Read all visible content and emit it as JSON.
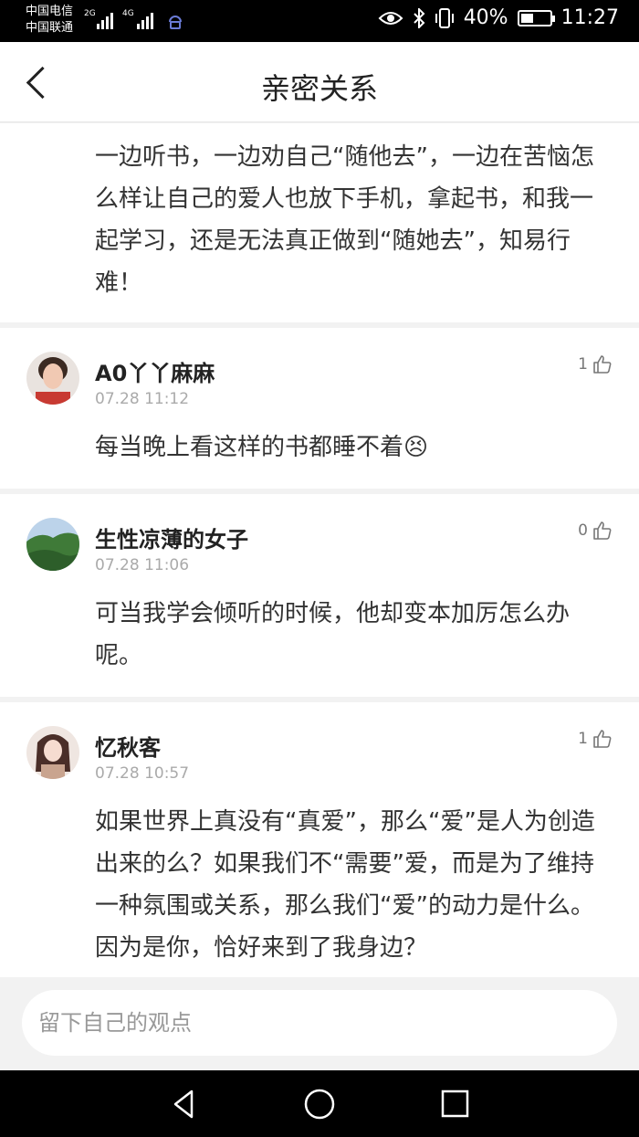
{
  "status_bar": {
    "carrier1": "中国电信",
    "carrier2": "中国联通",
    "net1": "2G",
    "net2": "4G",
    "battery": "40%",
    "time": "11:27"
  },
  "header": {
    "title": "亲密关系"
  },
  "first_card": {
    "text": "一边听书，一边劝自己“随他去”，一边在苦恼怎么样让自己的爱人也放下手机，拿起书，和我一起学习，还是无法真正做到“随她去”，知易行难！"
  },
  "comments": [
    {
      "name": "A0丫丫麻麻",
      "time": "07.28 11:12",
      "likes": "1",
      "text": "每当晚上看这样的书都睡不着😣",
      "avatar": "woman-portrait"
    },
    {
      "name": "生性凉薄的女子",
      "time": "07.28 11:06",
      "likes": "0",
      "text": "可当我学会倾听的时候，他却变本加厉怎么办呢。",
      "avatar": "green-landscape"
    },
    {
      "name": "忆秋客",
      "time": "07.28 10:57",
      "likes": "1",
      "text": "如果世界上真没有“真爱”，那么“爱”是人为创造出来的么？如果我们不“需要”爱，而是为了维持一种氛围或关系，那么我们“爱”的动力是什么。因为是你，恰好来到了我身边？",
      "avatar": "illustrated-girl"
    }
  ],
  "input": {
    "placeholder": "留下自己的观点"
  },
  "icons": {
    "back": "chevron-left-icon",
    "like": "thumbs-up-icon",
    "nav": [
      "back-triangle-icon",
      "home-circle-icon",
      "recents-square-icon"
    ]
  }
}
